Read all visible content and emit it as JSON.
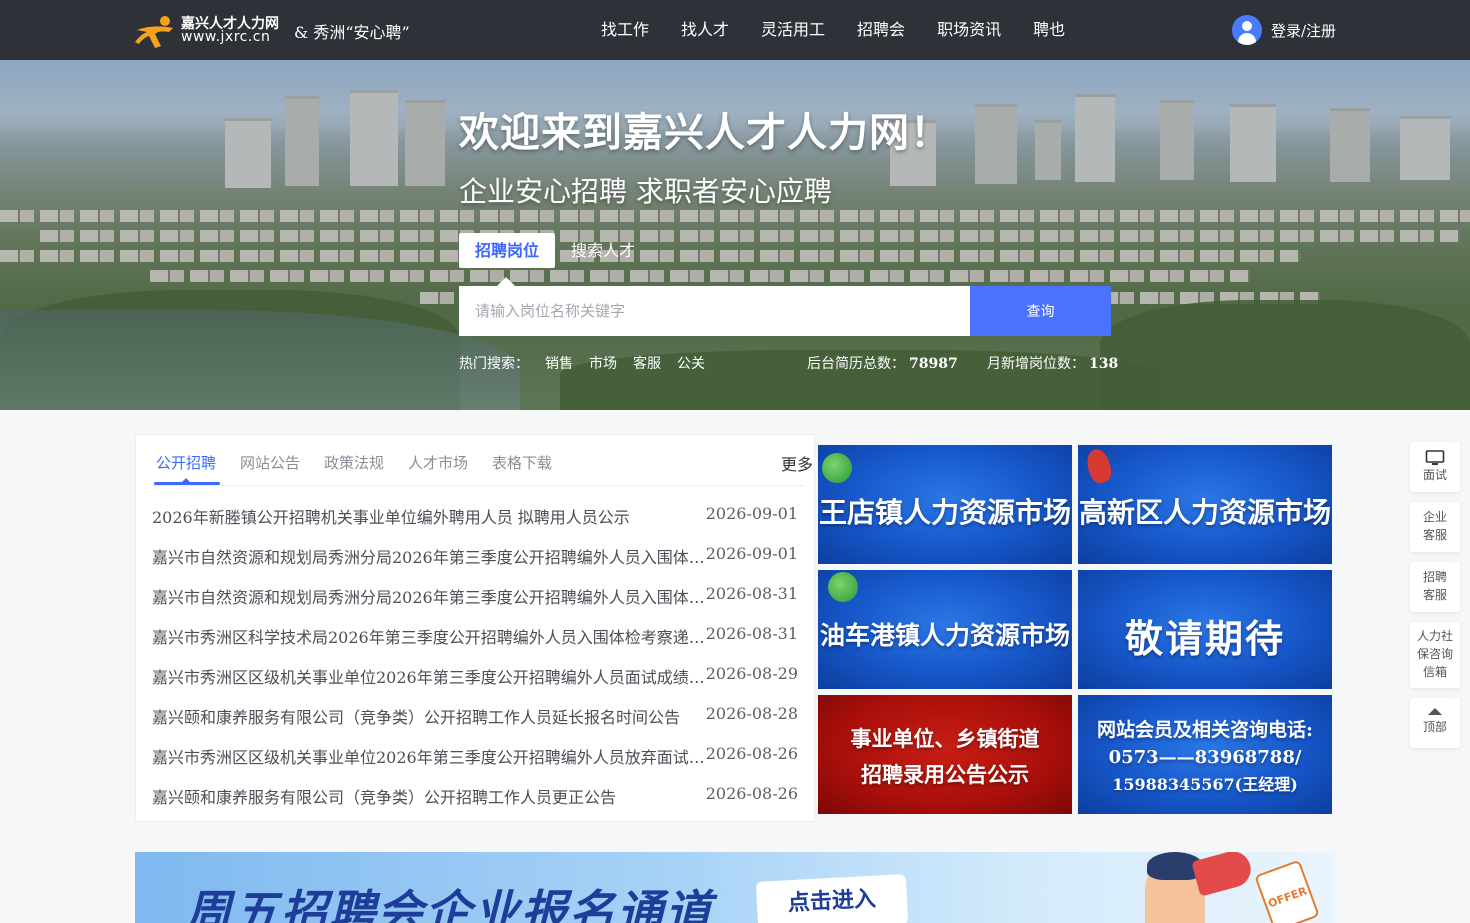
{
  "header": {
    "logo_cn": "嘉兴人才人力网",
    "logo_url": "www.jxrc.cn",
    "slogan": "& 秀洲“安心聘”",
    "nav": [
      "找工作",
      "找人才",
      "灵活用工",
      "招聘会",
      "职场资讯",
      "聘也"
    ],
    "login": "登录/注册",
    "colors": {
      "bar": "#2e3138",
      "accent": "#4a72ff"
    }
  },
  "hero": {
    "title": "欢迎来到嘉兴人才人力网！",
    "subtitle": "企业安心招聘 求职者安心应聘",
    "tab_jobs": "招聘岗位",
    "tab_talent": "搜索人才",
    "search_placeholder": "请输入岗位名称关键字",
    "search_button": "查询",
    "hot_label": "热门搜索：",
    "hot_tags": [
      "销售",
      "市场",
      "客服",
      "公关"
    ],
    "resume_label": "后台简历总数：",
    "resume_count": "78987",
    "jobs_label": "月新增岗位数：",
    "jobs_count": "138"
  },
  "news": {
    "tabs": [
      "公开招聘",
      "网站公告",
      "政策法规",
      "人才市场",
      "表格下载"
    ],
    "more": "更多",
    "items": [
      {
        "title": "2026年新塍镇公开招聘机关事业单位编外聘用人员 拟聘用人员公示",
        "date": "2026-09-01"
      },
      {
        "title": "嘉兴市自然资源和规划局秀洲分局2026年第三季度公开招聘编外人员入围体检人员名单公示",
        "date": "2026-09-01"
      },
      {
        "title": "嘉兴市自然资源和规划局秀洲分局2026年第三季度公开招聘编外人员入围体检人员名单公示",
        "date": "2026-08-31"
      },
      {
        "title": "嘉兴市秀洲区科学技术局2026年第三季度公开招聘编外人员入围体检考察递补人员公告",
        "date": "2026-08-31"
      },
      {
        "title": "嘉兴市秀洲区区级机关事业单位2026年第三季度公开招聘编外人员面试成绩、入围体检人员名单公布",
        "date": "2026-08-29"
      },
      {
        "title": "嘉兴颐和康养服务有限公司（竞争类）公开招聘工作人员延长报名时间公告",
        "date": "2026-08-28"
      },
      {
        "title": "嘉兴市秀洲区区级机关事业单位2026年第三季度公开招聘编外人员放弃面试递补人员公告",
        "date": "2026-08-26"
      },
      {
        "title": "嘉兴颐和康养服务有限公司（竞争类）公开招聘工作人员更正公告",
        "date": "2026-08-26"
      }
    ]
  },
  "tiles": {
    "wangdian": "王店镇人力资源市场",
    "gaoxin": "高新区人力资源市场",
    "youchegang": "油车港镇人力资源市场",
    "coming_soon": "敬请期待",
    "public_line1": "事业单位、乡镇街道",
    "public_line2": "招聘录用公告公示",
    "hotline_line1": "网站会员及相关咨询电话:",
    "hotline_line2": "0573——83968788/",
    "hotline_line3": "15988345567(王经理)"
  },
  "float_sidebar": {
    "interview": "面试",
    "enterprise_service_1": "企业",
    "enterprise_service_2": "客服",
    "recruit_service_1": "招聘",
    "recruit_service_2": "客服",
    "social_1": "人力社",
    "social_2": "保咨询",
    "social_3": "信箱",
    "top": "顶部"
  },
  "bottom_banner": {
    "title": "周五招聘会企业报名通道",
    "button": "点击进入",
    "badge": "OFFER"
  }
}
